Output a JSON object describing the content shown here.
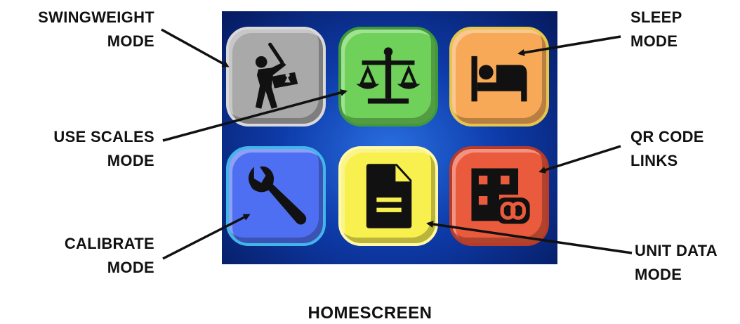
{
  "labels": {
    "swingweight": [
      "SWINGWEIGHT",
      "MODE"
    ],
    "sleep": [
      "SLEEP",
      "MODE"
    ],
    "use_scales": [
      "USE SCALES",
      "MODE"
    ],
    "qr_code": [
      "QR CODE",
      "LINKS"
    ],
    "calibrate": [
      "CALIBRATE",
      "MODE"
    ],
    "unit_data": [
      "UNIT DATA",
      "MODE"
    ]
  },
  "caption": "HOMESCREEN",
  "tiles": [
    {
      "name": "swingweight",
      "color": "#a9a9a9",
      "icon": "golfer-icon"
    },
    {
      "name": "use-scales",
      "color": "#6fd15a",
      "icon": "scales-icon"
    },
    {
      "name": "sleep",
      "color": "#f7a957",
      "icon": "bed-icon"
    },
    {
      "name": "calibrate",
      "color": "#4f6ff2",
      "icon": "wrench-icon"
    },
    {
      "name": "unit-data",
      "color": "#f8f04e",
      "icon": "document-icon"
    },
    {
      "name": "qr-code",
      "color": "#ea5a3c",
      "icon": "qr-link-icon"
    }
  ]
}
